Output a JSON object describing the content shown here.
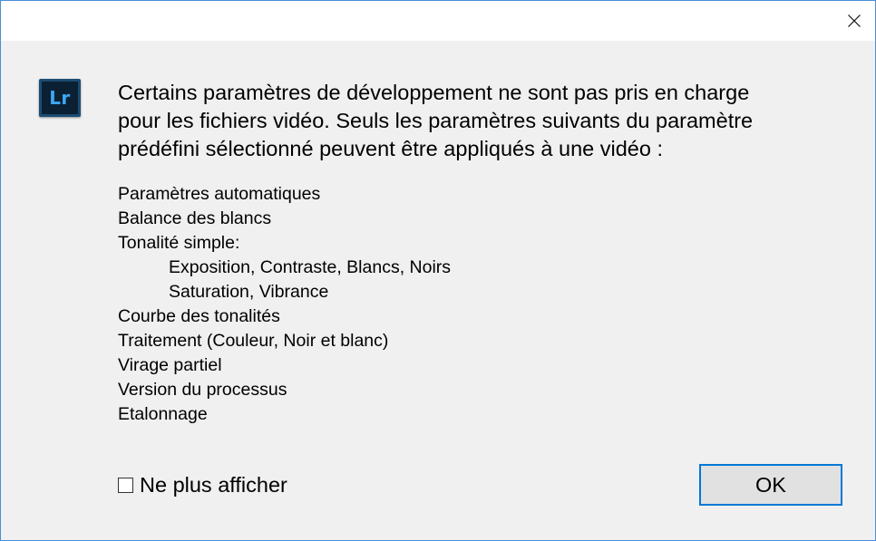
{
  "titlebar": {
    "close_icon": "close-icon"
  },
  "app_icon": {
    "text": "Lr",
    "background": "#0b2033",
    "text_color": "#3ea6f5"
  },
  "message": {
    "lines": [
      "Certains paramètres de développement ne sont pas pris en charge",
      "pour les fichiers vidéo. Seuls les paramètres suivants du paramètre",
      "prédéfini sélectionné peuvent être appliqués à une vidéo :"
    ]
  },
  "settings": [
    {
      "label": "Paramètres automatiques"
    },
    {
      "label": "Balance des blancs"
    },
    {
      "label": "Tonalité simple:"
    },
    {
      "label": "Exposition, Contraste, Blancs, Noirs"
    },
    {
      "label": "Saturation, Vibrance"
    },
    {
      "label": "Courbe des tonalités"
    },
    {
      "label": "Traitement (Couleur, Noir et blanc)"
    },
    {
      "label": "Virage partiel"
    },
    {
      "label": "Version du processus"
    },
    {
      "label": "Etalonnage"
    }
  ],
  "dont_show_again": {
    "label": "Ne plus afficher",
    "checked": false
  },
  "ok_button": {
    "label": "OK",
    "border_color": "#0078d7"
  }
}
